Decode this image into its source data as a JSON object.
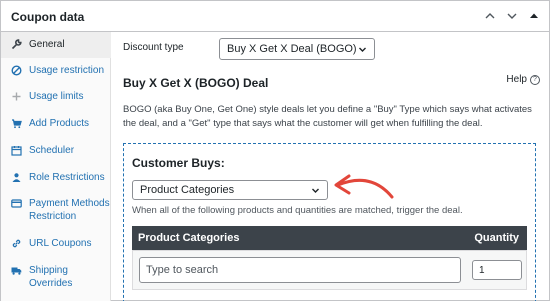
{
  "panel": {
    "title": "Coupon data"
  },
  "sidebar": {
    "items": [
      {
        "label": "General",
        "icon": "wrench-icon",
        "active": true
      },
      {
        "label": "Usage restriction",
        "icon": "block-icon"
      },
      {
        "label": "Usage limits",
        "icon": "plus-icon"
      },
      {
        "label": "Add Products",
        "icon": "cart-icon"
      },
      {
        "label": "Scheduler",
        "icon": "calendar-icon"
      },
      {
        "label": "Role Restrictions",
        "icon": "user-icon"
      },
      {
        "label": "Payment Methods Restriction",
        "icon": "card-icon"
      },
      {
        "label": "URL Coupons",
        "icon": "link-icon"
      },
      {
        "label": "Shipping Overrides",
        "icon": "truck-icon"
      }
    ]
  },
  "main": {
    "discount_type_label": "Discount type",
    "discount_type_value": "Buy X Get X Deal (BOGO)",
    "deal_title": "Buy X Get X (BOGO) Deal",
    "help_label": "Help",
    "description": "BOGO (aka Buy One, Get One) style deals let you define a \"Buy\" Type which says what activates the deal, and a \"Get\" type that says what the customer will get when fulfilling the deal."
  },
  "customer_buys": {
    "title": "Customer Buys:",
    "type_value": "Product Categories",
    "match_text": "When all of the following products and quantities are matched, trigger the deal.",
    "table": {
      "col1": "Product Categories",
      "col2": "Quantity",
      "search_placeholder": "Type to search",
      "quantity_value": "1"
    }
  },
  "colors": {
    "accent": "#2271b1",
    "arrow": "#e2463a",
    "table_header": "#3c434a"
  }
}
